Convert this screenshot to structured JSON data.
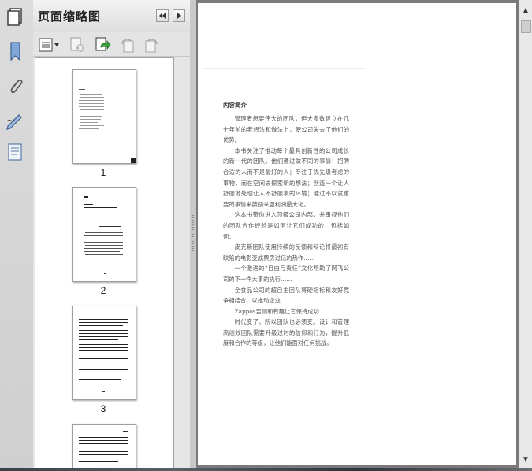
{
  "panel": {
    "title": "页面缩略图",
    "thumbnails": [
      {
        "label": "1"
      },
      {
        "label": "2"
      },
      {
        "label": "3"
      },
      {
        "label": ""
      }
    ]
  },
  "left_strip": {
    "icons": [
      "bookmark-icon",
      "attachment-icon",
      "signature-icon",
      "layers-icon"
    ]
  },
  "toolbar": {
    "icons": [
      "options-menu-icon",
      "delete-page-icon",
      "insert-page-icon",
      "rotate-left-icon",
      "rotate-right-icon"
    ]
  },
  "document": {
    "section_title": "内容简介",
    "paragraphs": [
      "管理者想要伟大的团队，但大多数建立在几十年前的老想法和做法上，使公司失去了他们的优势。",
      "本书关注了推动每个最具创新性的公司成长的新一代的团队。他们通过做不同的事情：招聘合适的人而不是最好的人；专注于优先级考虑的事物，而在空间去探索新的想法；创造一个让人舒服地处理让人不舒服事的环境；通过不以就重要的事情来鼓励来更利润最大化。",
      "这本书带你进入顶级公司内部，并审视他们的团队合作经验是如何让它们成功的，包括如何：",
      "皮克斯团队使用持续的反馈和辩论将最初有缺陷的电影变成票房过亿的热作……",
      "一个激进的“自由与责任”文化帮助了网飞公司的下一件大事的执行……",
      "全食品公司的超自主团队将硬指标和友好竞争相结合，以推动企业……",
      "Zappos吉顾和有趣让它保持成功……",
      "时代变了。所以团队也必须变。设计和管理高绩效团队需要升级过时的信仰和行为，提升低度和合作的等级，让他们能面对任何挑战。"
    ]
  }
}
